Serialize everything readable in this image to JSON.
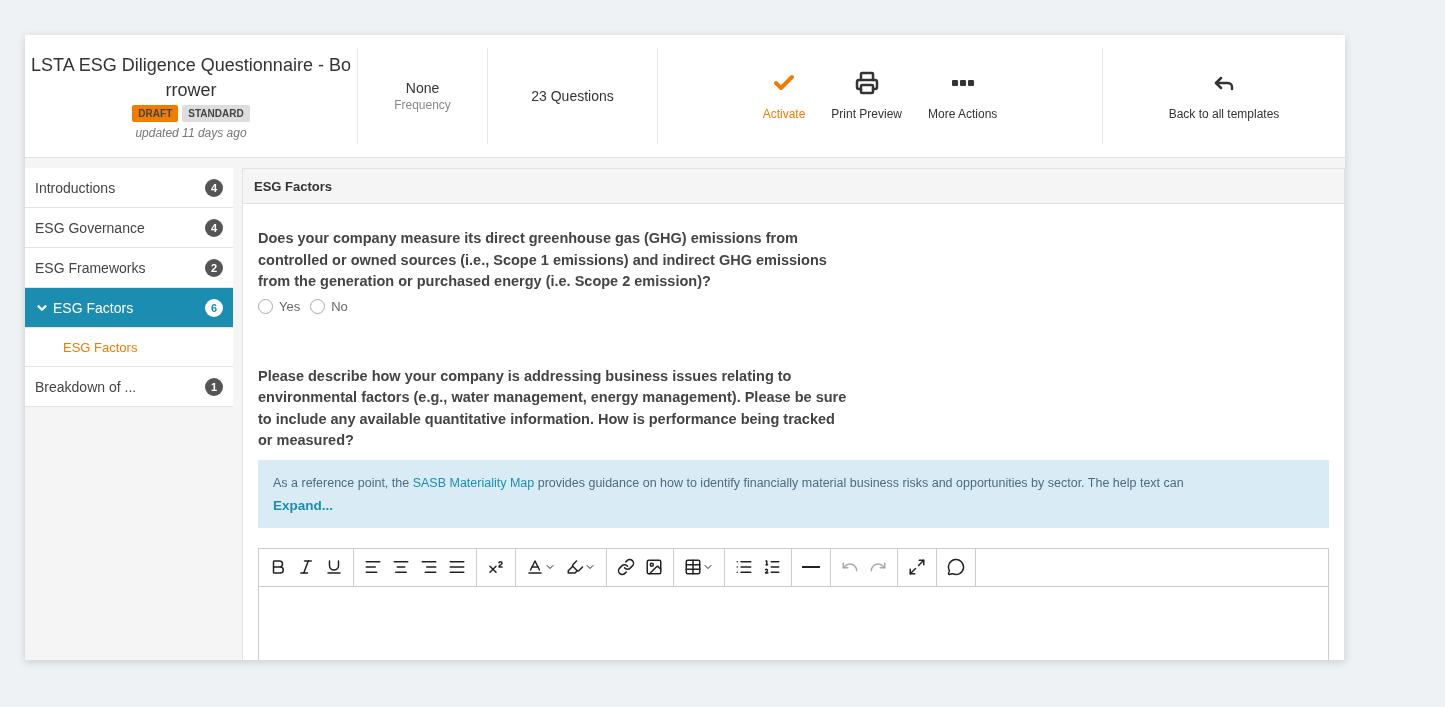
{
  "header": {
    "title": "LSTA ESG Diligence Questionnaire - Bo rrower",
    "tags": [
      {
        "label": "DRAFT",
        "color": "#f07c00"
      },
      {
        "label": "STANDARD",
        "color": "#dddddd"
      }
    ],
    "updated": "updated 11 days ago",
    "frequency": {
      "value": "None",
      "label": "Frequency"
    },
    "questions": "23 Questions",
    "actions": [
      {
        "kind": "check",
        "label": "Activate",
        "color": "#f07c00"
      },
      {
        "kind": "print",
        "label": "Print Preview",
        "color": "#333333"
      },
      {
        "kind": "more",
        "label": "More Actions",
        "color": "#333333"
      }
    ],
    "back": {
      "kind": "back",
      "label": "Back to all templates"
    }
  },
  "sidebar": {
    "items": [
      {
        "label": "Introductions",
        "count": "4",
        "selected": false,
        "expanded": false
      },
      {
        "label": "ESG Governance",
        "count": "4",
        "selected": false,
        "expanded": false
      },
      {
        "label": "ESG Frameworks",
        "count": "2",
        "selected": false,
        "expanded": false
      },
      {
        "label": "ESG Factors",
        "count": "6",
        "selected": true,
        "expanded": true,
        "children": [
          {
            "label": "ESG Factors",
            "selected": true
          }
        ]
      },
      {
        "label": "Breakdown of ...",
        "count": "1",
        "selected": false,
        "expanded": false
      }
    ]
  },
  "section": {
    "title": "ESG Factors",
    "questions": [
      {
        "kind": "radio",
        "text": "Does your company measure its direct greenhouse gas (GHG) emissions from controlled or owned sources (i.e., Scope 1 emissions) and indirect GHG emissions from the generation or purchased energy (i.e. Scope 2 emission)?",
        "options": [
          {
            "label": "Yes",
            "selected": false
          },
          {
            "label": "No",
            "selected": false
          }
        ]
      },
      {
        "kind": "text",
        "text": "Please describe how your company is addressing business issues relating to environmental factors (e.g., water management, energy management). Please be sure to include any available quantitative information. How is performance being tracked or measured?",
        "help": {
          "before": "As a reference point, the",
          "link": "SASB Materiality Map",
          "after": "provides guidance on how to identify financially material business risks and opportunities by sector. The help text can",
          "expand": "Expand..."
        },
        "toolbar": [
          [
            {
              "kind": "bold",
              "disabled": false
            },
            {
              "kind": "italic",
              "disabled": false
            },
            {
              "kind": "underline",
              "disabled": false
            }
          ],
          [
            {
              "kind": "align-left",
              "disabled": false
            },
            {
              "kind": "align-center",
              "disabled": false
            },
            {
              "kind": "align-right",
              "disabled": false
            },
            {
              "kind": "justify",
              "disabled": false
            }
          ],
          [
            {
              "kind": "superscript",
              "disabled": false
            }
          ],
          [
            {
              "kind": "text-color",
              "disabled": false
            },
            {
              "kind": "highlight",
              "disabled": false
            }
          ],
          [
            {
              "kind": "link",
              "disabled": false
            },
            {
              "kind": "image",
              "disabled": false
            }
          ],
          [
            {
              "kind": "table",
              "disabled": false
            }
          ],
          [
            {
              "kind": "bullets",
              "disabled": false
            },
            {
              "kind": "numbers",
              "disabled": false
            }
          ],
          [
            {
              "kind": "rule",
              "disabled": false
            }
          ],
          [
            {
              "kind": "undo",
              "disabled": true
            },
            {
              "kind": "redo",
              "disabled": true
            }
          ],
          [
            {
              "kind": "fullscreen",
              "disabled": false
            }
          ],
          [
            {
              "kind": "comment",
              "disabled": false
            }
          ]
        ]
      }
    ]
  }
}
